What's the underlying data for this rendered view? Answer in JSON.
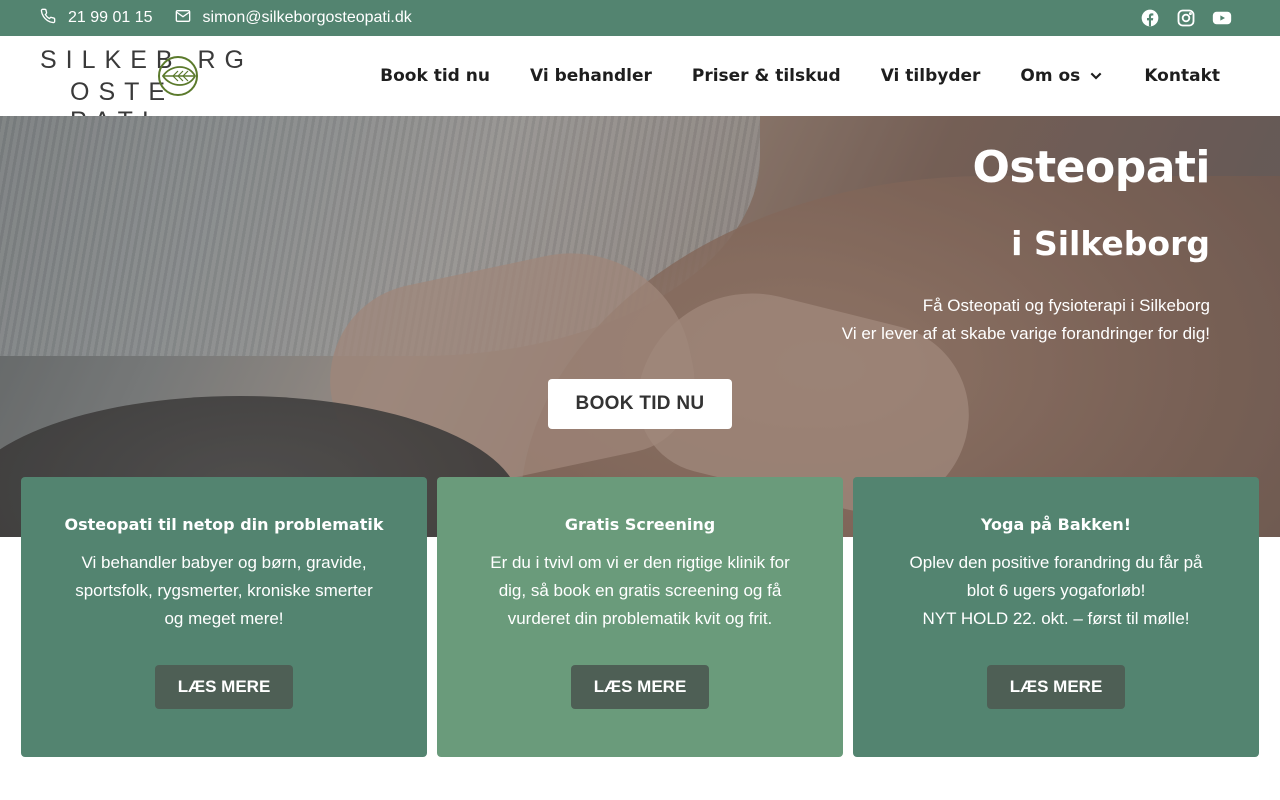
{
  "topbar": {
    "phone": "21 99 01 15",
    "email": "simon@silkeborgosteopati.dk",
    "social": [
      "facebook-icon",
      "instagram-icon",
      "youtube-icon"
    ]
  },
  "logo": {
    "line1": "SILKEB RG",
    "line2": "OSTE PATI"
  },
  "nav": {
    "items": [
      "Book tid nu",
      "Vi behandler",
      "Priser & tilskud",
      "Vi tilbyder",
      "Om os",
      "Kontakt"
    ]
  },
  "hero": {
    "title": "Osteopati",
    "subtitle": "i Silkeborg",
    "line1": "Få Osteopati og fysioterapi i Silkeborg",
    "line2": "Vi er lever af at skabe varige forandringer for dig!",
    "cta": "BOOK TID NU"
  },
  "cards": [
    {
      "title": "Osteopati til netop din problematik",
      "text": "Vi behandler babyer og børn, gravide, sportsfolk, rygsmerter, kroniske smerter og meget mere!",
      "button": "LÆS MERE"
    },
    {
      "title": "Gratis Screening",
      "text": "Er du i tvivl om vi er den rigtige klinik for dig, så book en gratis screening og få vurderet din problematik kvit og frit.",
      "button": "LÆS MERE"
    },
    {
      "title": "Yoga på Bakken!",
      "text_line1": "Oplev den positive forandring du får på blot 6 ugers yogaforløb!",
      "text_line2": "NYT HOLD 22. okt. – først til mølle!",
      "button": "LÆS MERE"
    }
  ],
  "colors": {
    "brand_green": "#538470",
    "light_green": "#6a9b7b",
    "button_dark": "#4e5f55",
    "logo_leaf": "#5b7a2c"
  }
}
